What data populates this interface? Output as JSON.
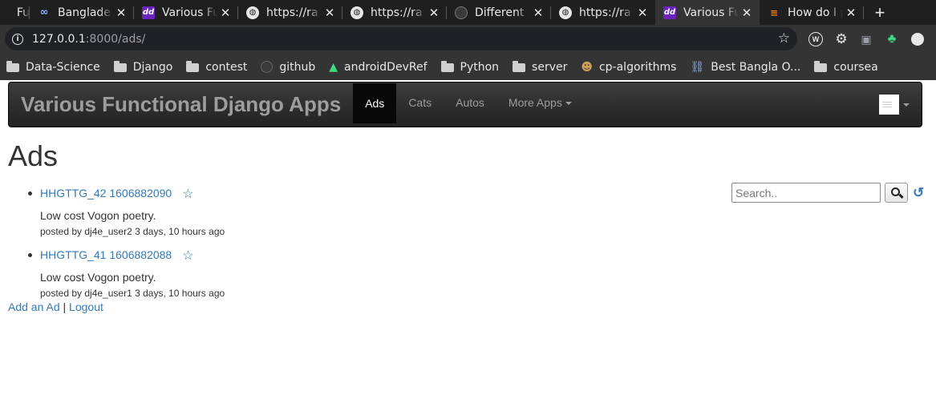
{
  "browser": {
    "tabs": [
      {
        "label": "Fu",
        "icon": "unknown-icon"
      },
      {
        "label": "Banglade",
        "icon": "infinity-icon"
      },
      {
        "label": "Various Fu",
        "icon": "dd-icon"
      },
      {
        "label": "https://ra",
        "icon": "globe-icon"
      },
      {
        "label": "https://ra",
        "icon": "globe-icon"
      },
      {
        "label": "Different",
        "icon": "github-icon"
      },
      {
        "label": "https://ra",
        "icon": "globe-icon"
      },
      {
        "label": "Various Fu",
        "icon": "dd-icon",
        "active": true
      },
      {
        "label": "How do I p",
        "icon": "stackoverflow-icon"
      }
    ],
    "new_tab": "+",
    "url_host": "127.0.0.1",
    "url_path": ":8000/ads/",
    "bookmarks": [
      {
        "label": "Data-Science",
        "icon": "folder-icon"
      },
      {
        "label": "Django",
        "icon": "folder-icon"
      },
      {
        "label": "contest",
        "icon": "folder-icon"
      },
      {
        "label": "github",
        "icon": "github-icon"
      },
      {
        "label": "androidDevRef",
        "icon": "android-icon"
      },
      {
        "label": "Python",
        "icon": "folder-icon"
      },
      {
        "label": "server",
        "icon": "folder-icon"
      },
      {
        "label": "cp-algorithms",
        "icon": "cp-icon"
      },
      {
        "label": "Best Bangla O...",
        "icon": "link-icon"
      },
      {
        "label": "coursea",
        "icon": "folder-icon"
      }
    ]
  },
  "navbar": {
    "brand": "Various Functional Django Apps",
    "items": [
      "Ads",
      "Cats",
      "Autos",
      "More Apps"
    ],
    "active": "Ads"
  },
  "page": {
    "title": "Ads",
    "search_placeholder": "Search..",
    "ads": [
      {
        "title": "HHGTTG_42 1606882090",
        "text": "Low cost Vogon poetry.",
        "meta": "posted by dj4e_user2 3 days, 10 hours ago"
      },
      {
        "title": "HHGTTG_41 1606882088",
        "text": "Low cost Vogon poetry.",
        "meta": "posted by dj4e_user1 3 days, 10 hours ago"
      }
    ],
    "add_link": "Add an Ad",
    "separator": "|",
    "logout_link": "Logout"
  },
  "colors": {
    "link": "#337ab7",
    "navbar_bg": "#222222",
    "browser_bg": "#1f1f1f"
  }
}
